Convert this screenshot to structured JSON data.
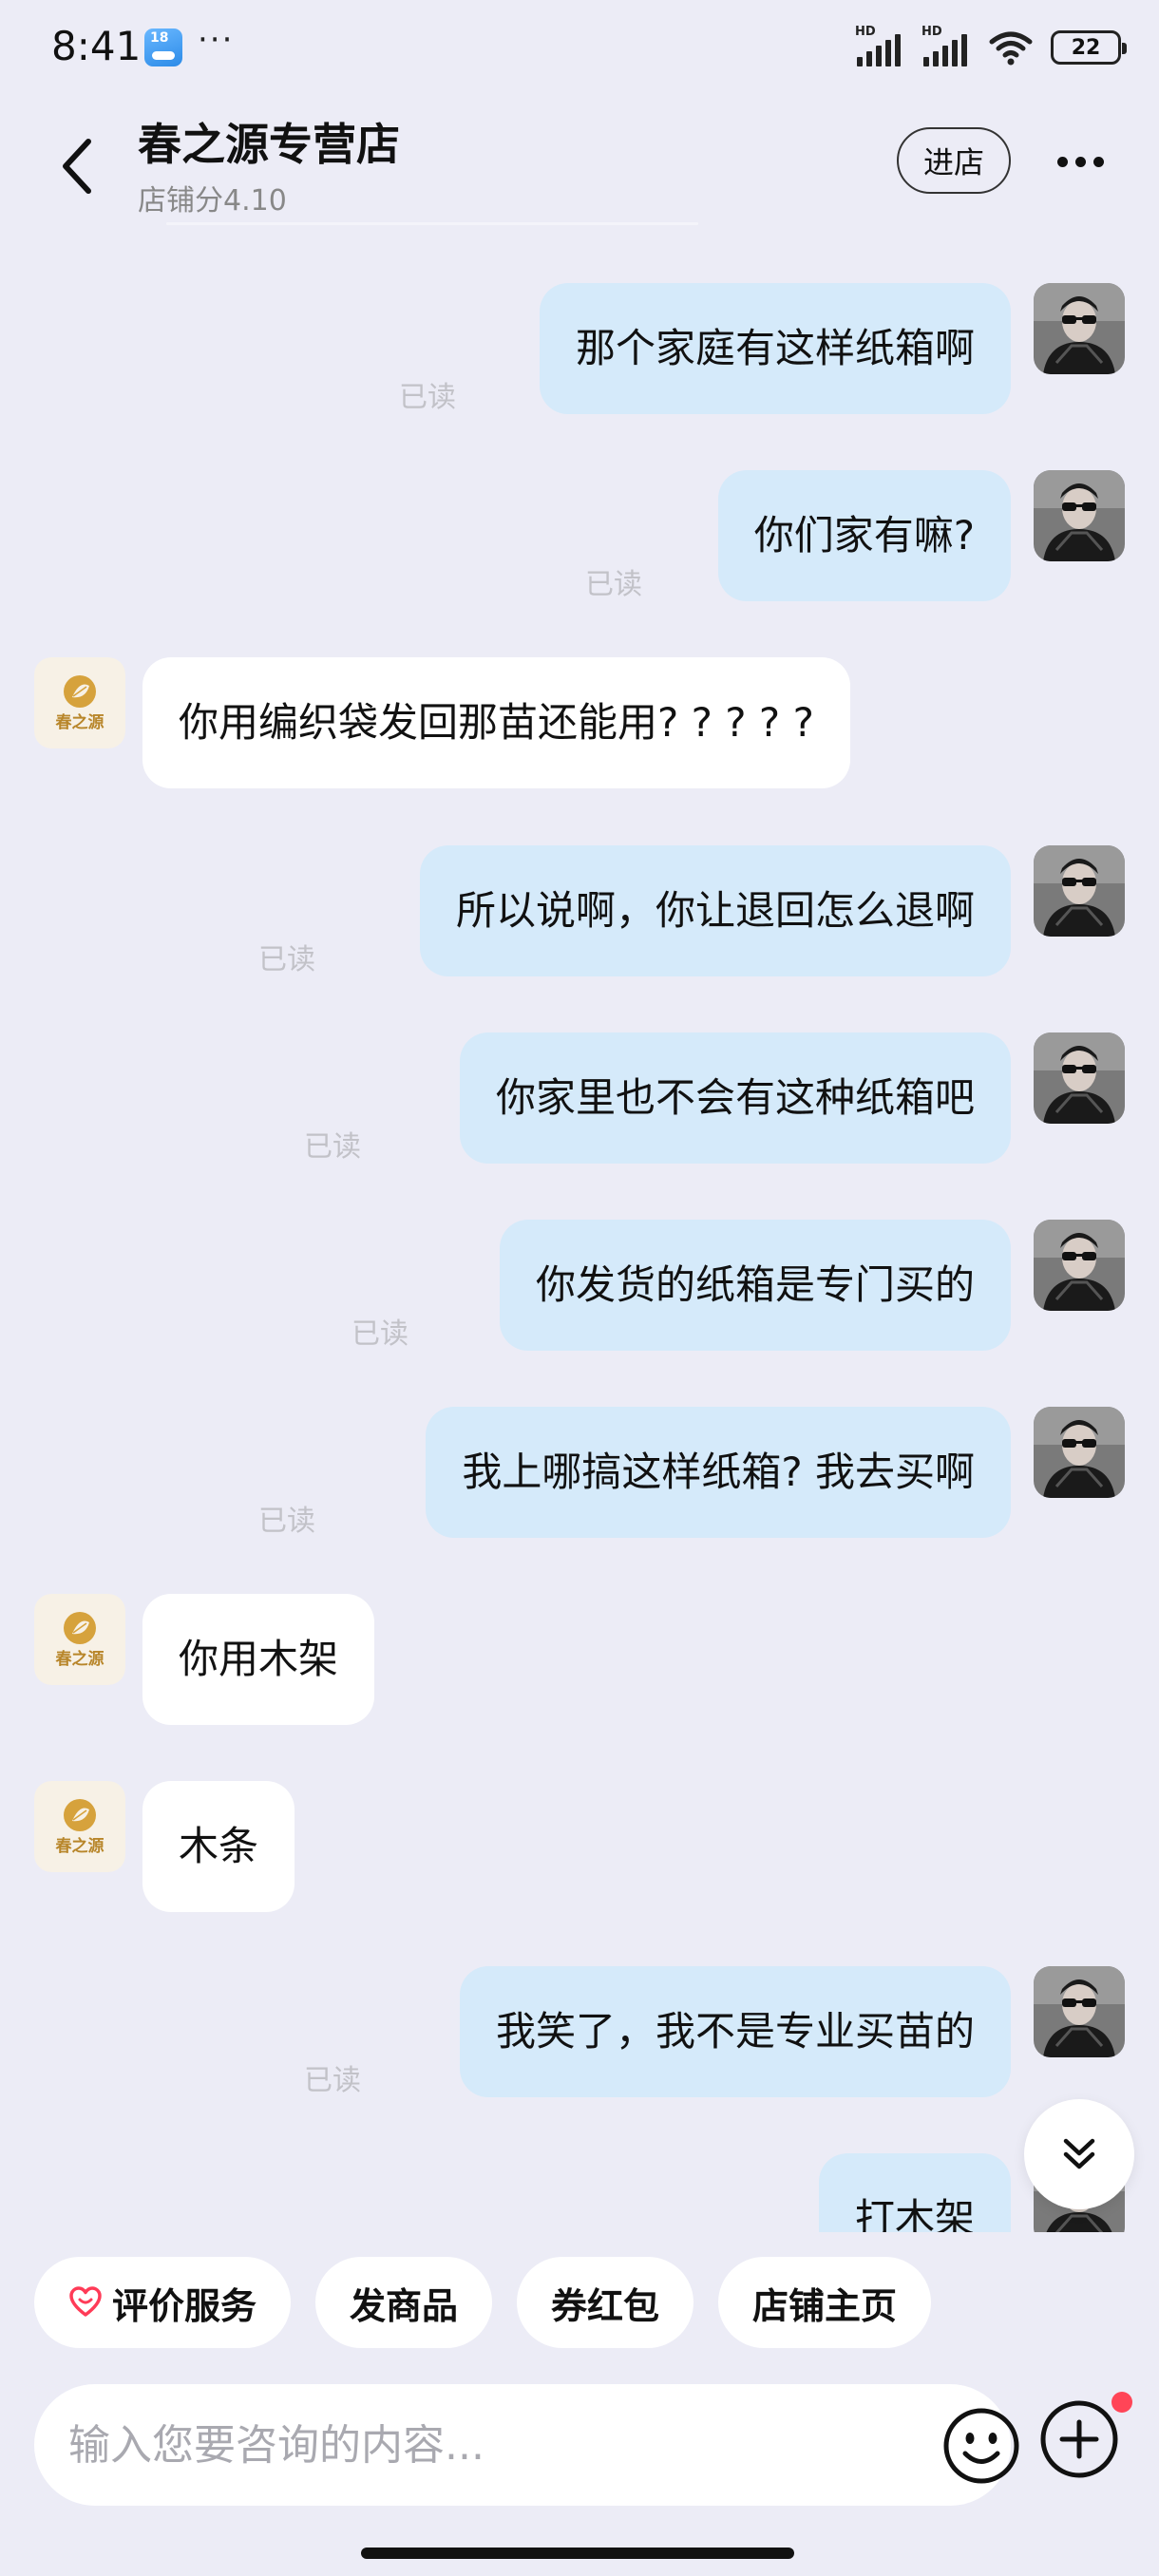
{
  "status_bar": {
    "time": "8:41",
    "notification_badge": "18",
    "more_dots": "···",
    "signal_label_1": "HD",
    "signal_label_2": "HD",
    "battery_level": "22"
  },
  "header": {
    "shop_name": "春之源专营店",
    "shop_score": "店铺分4.10",
    "enter_store_label": "进店"
  },
  "messages": [
    {
      "direction": "out",
      "text": "那个家庭有这样纸箱啊",
      "read_label": "已读"
    },
    {
      "direction": "out",
      "text": "你们家有嘛?",
      "read_label": "已读"
    },
    {
      "direction": "in",
      "text": "你用编织袋发回那苗还能用? ? ? ? ?"
    },
    {
      "direction": "out",
      "text": "所以说啊，你让退回怎么退啊",
      "read_label": "已读"
    },
    {
      "direction": "out",
      "text": "你家里也不会有这种纸箱吧",
      "read_label": "已读"
    },
    {
      "direction": "out",
      "text": "你发货的纸箱是专门买的",
      "read_label": "已读"
    },
    {
      "direction": "out",
      "text": "我上哪搞这样纸箱? 我去买啊",
      "read_label": "已读"
    },
    {
      "direction": "in",
      "text": "你用木架"
    },
    {
      "direction": "in",
      "text": "木条"
    },
    {
      "direction": "out",
      "text": "我笑了，我不是专业买苗的",
      "read_label": "已读"
    },
    {
      "direction": "out",
      "text": "打木架"
    }
  ],
  "shop_avatar_text": "春之源",
  "quick_actions": [
    {
      "label": "评价服务",
      "icon": "heart-icon"
    },
    {
      "label": "发商品"
    },
    {
      "label": "券红包"
    },
    {
      "label": "店铺主页"
    }
  ],
  "input": {
    "placeholder": "输入您要咨询的内容...",
    "value": ""
  },
  "colors": {
    "background": "#ececf6",
    "outgoing_bubble": "#d5eafa",
    "incoming_bubble": "#ffffff",
    "notification_dot": "#ff4557",
    "heart_accent": "#ff3b57"
  }
}
